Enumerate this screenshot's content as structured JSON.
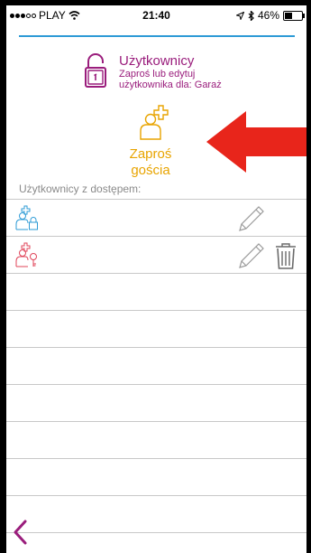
{
  "status_bar": {
    "carrier": "PLAY",
    "time": "21:40",
    "battery": "46%",
    "battery_level": 0.46
  },
  "header": {
    "title": "Użytkownicy",
    "subtitle_line1": "Zaproś lub edytuj",
    "subtitle_line2": "użytkownika dla: Garaż",
    "icon": "unlocked-padlock-icon"
  },
  "invite": {
    "label_line1": "Zaproś",
    "label_line2": "gościa",
    "icon": "person-plus-icon"
  },
  "users_section": {
    "label": "Użytkownicy z dostępem:",
    "users": [
      {
        "icon": "user-lock-icon",
        "color": "#2e9bd6",
        "editable": true,
        "deletable": false
      },
      {
        "icon": "user-key-icon",
        "color": "#e0455a",
        "editable": true,
        "deletable": true
      }
    ]
  },
  "colors": {
    "accent_blue": "#2e9bd6",
    "header_purple": "#9a1d7c",
    "invite_orange": "#e8a400",
    "arrow_red": "#e8251b"
  },
  "navigation": {
    "back_icon": "chevron-left-icon"
  }
}
